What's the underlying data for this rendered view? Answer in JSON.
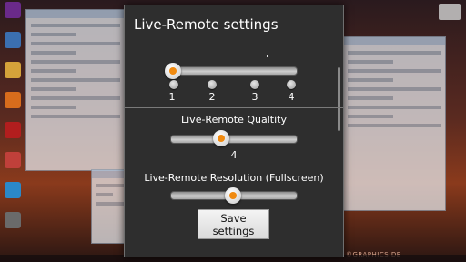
{
  "dialog": {
    "title": "Live-Remote settings",
    "ticks": [
      "1",
      "2",
      "3",
      "4"
    ],
    "top_slider_level": 0.0,
    "quality": {
      "label": "Live-Remote Qualtity",
      "value": "4",
      "level": 0.4
    },
    "resolution": {
      "label": "Live-Remote Resolution (Fullscreen)",
      "level": 0.5
    },
    "save_label": "Save settings"
  },
  "desktop": {
    "watermark": "©GRAPHICS.DE"
  },
  "colors": {
    "accent": "#f08a10",
    "dialog_bg": "#2e2e2e"
  },
  "icons": [
    "desktop-app-icon",
    "keyboard-icon"
  ]
}
